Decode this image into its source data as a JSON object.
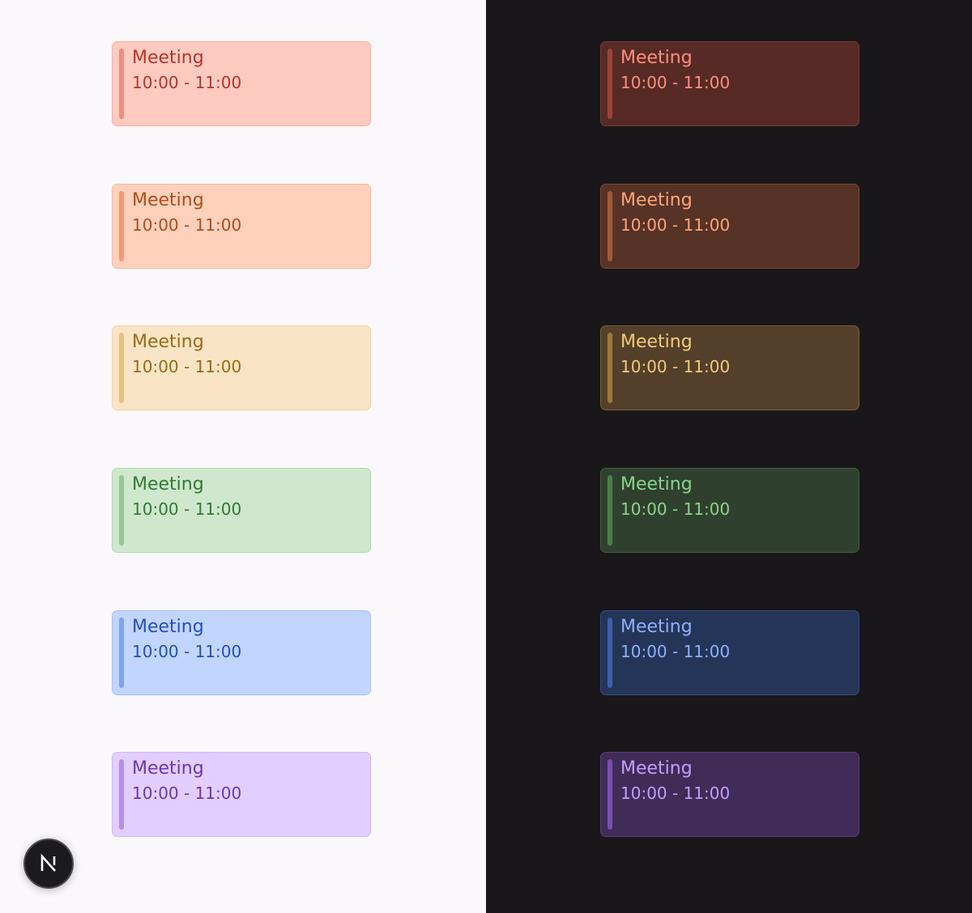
{
  "light": {
    "cards": [
      {
        "title": "Meeting",
        "time": "10:00 - 11:00",
        "color": "red"
      },
      {
        "title": "Meeting",
        "time": "10:00 - 11:00",
        "color": "orange"
      },
      {
        "title": "Meeting",
        "time": "10:00 - 11:00",
        "color": "amber"
      },
      {
        "title": "Meeting",
        "time": "10:00 - 11:00",
        "color": "green"
      },
      {
        "title": "Meeting",
        "time": "10:00 - 11:00",
        "color": "blue"
      },
      {
        "title": "Meeting",
        "time": "10:00 - 11:00",
        "color": "purple"
      }
    ]
  },
  "dark": {
    "cards": [
      {
        "title": "Meeting",
        "time": "10:00 - 11:00",
        "color": "red"
      },
      {
        "title": "Meeting",
        "time": "10:00 - 11:00",
        "color": "orange"
      },
      {
        "title": "Meeting",
        "time": "10:00 - 11:00",
        "color": "amber"
      },
      {
        "title": "Meeting",
        "time": "10:00 - 11:00",
        "color": "green"
      },
      {
        "title": "Meeting",
        "time": "10:00 - 11:00",
        "color": "blue"
      },
      {
        "title": "Meeting",
        "time": "10:00 - 11:00",
        "color": "purple"
      }
    ]
  },
  "colors": {
    "light_background": "#fbf8fb",
    "dark_background": "#19171a"
  },
  "badge": {
    "icon": "nextjs-logo-icon"
  }
}
